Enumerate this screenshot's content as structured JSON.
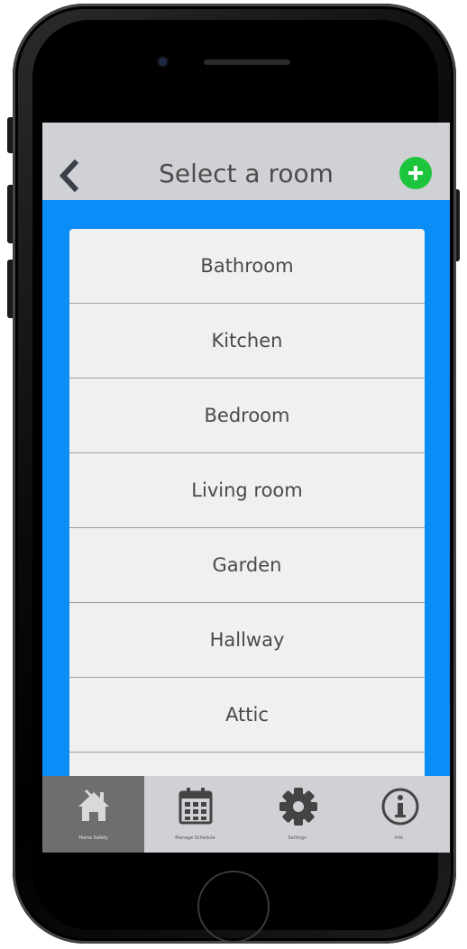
{
  "header": {
    "title": "Select a room",
    "back_icon": "chevron-left-icon",
    "add_icon": "plus-circle-icon"
  },
  "rooms": [
    "Bathroom",
    "Kitchen",
    "Bedroom",
    "Living room",
    "Garden",
    "Hallway",
    "Attic",
    ""
  ],
  "tabs": [
    {
      "label": "Home Safety",
      "icon": "house-tools-icon",
      "active": true
    },
    {
      "label": "Manage Schedule",
      "icon": "calendar-icon",
      "active": false
    },
    {
      "label": "Settings",
      "icon": "gear-icon",
      "active": false
    },
    {
      "label": "Info",
      "icon": "info-icon",
      "active": false
    }
  ],
  "colors": {
    "background": "#0a8df6",
    "nav_bar": "#cfd1d5",
    "add_button": "#1cc53b",
    "active_tab": "#6e6e6e",
    "list_bg": "#f0f0f0"
  }
}
